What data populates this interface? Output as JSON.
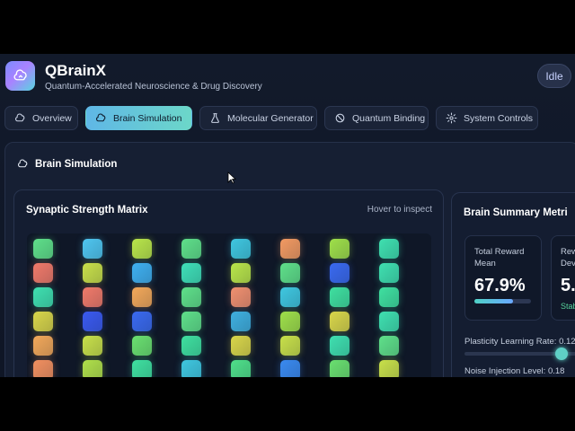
{
  "app": {
    "title": "QBrainX",
    "subtitle": "Quantum-Accelerated Neuroscience & Drug Discovery",
    "status": "Idle"
  },
  "tabs": [
    {
      "label": "Overview",
      "icon": "brain-icon",
      "active": false
    },
    {
      "label": "Brain Simulation",
      "icon": "brain-icon",
      "active": true
    },
    {
      "label": "Molecular Generator",
      "icon": "flask-icon",
      "active": false
    },
    {
      "label": "Quantum Binding",
      "icon": "atom-icon",
      "active": false
    },
    {
      "label": "System Controls",
      "icon": "gear-icon",
      "active": false
    }
  ],
  "section": {
    "title": "Brain Simulation"
  },
  "matrix": {
    "title": "Synaptic Strength Matrix",
    "hint": "Hover to inspect",
    "rows": [
      [
        "#5fe08a",
        "#4fc6f0",
        "#b9e64a",
        "#5fe08a",
        "#3fc7e0",
        "#f29a62",
        "#9fe04a",
        "#3fe0b0"
      ],
      [
        "#f07a6a",
        "#c8e04a",
        "#3fb0f0",
        "#3fe0b8",
        "#b9e64a",
        "#5fe08a",
        "#3a6af0",
        "#3fe0b0"
      ],
      [
        "#3fe0b0",
        "#f07a6a",
        "#f2a85a",
        "#5fe08a",
        "#f09070",
        "#3fc7e0",
        "#3fe0a0",
        "#3fe0a0"
      ],
      [
        "#d9d64a",
        "#3a5af0",
        "#3a6af0",
        "#5fe08a",
        "#3fb0e0",
        "#9fe04a",
        "#d9d64a",
        "#3fe0b0"
      ],
      [
        "#f2a85a",
        "#c8e04a",
        "#6ae070",
        "#3fe0a0",
        "#d9d64a",
        "#c8e04a",
        "#3fe0b0",
        "#5fe08a"
      ],
      [
        "#f29060",
        "#b0e04a",
        "#3fe0a0",
        "#3fc7e0",
        "#4fe08a",
        "#3a8af0",
        "#6ae070",
        "#c8e04a"
      ]
    ]
  },
  "summary": {
    "title": "Brain Summary Metri",
    "tiles": [
      {
        "label_line1": "Total Reward",
        "label_line2": "Mean",
        "value": "67.9%",
        "fill": 0.679
      },
      {
        "label_line1": "Rew",
        "label_line2": "Devi",
        "value": "5.",
        "note": "Stab"
      }
    ],
    "sliders": [
      {
        "label": "Plasticity Learning Rate: 0.120",
        "position": 0.72
      },
      {
        "label": "Noise Injection Level: 0.18"
      }
    ]
  },
  "colors": {
    "accent_start": "#5fb7e6",
    "accent_end": "#6cd7c9",
    "background": "#121a2b"
  }
}
